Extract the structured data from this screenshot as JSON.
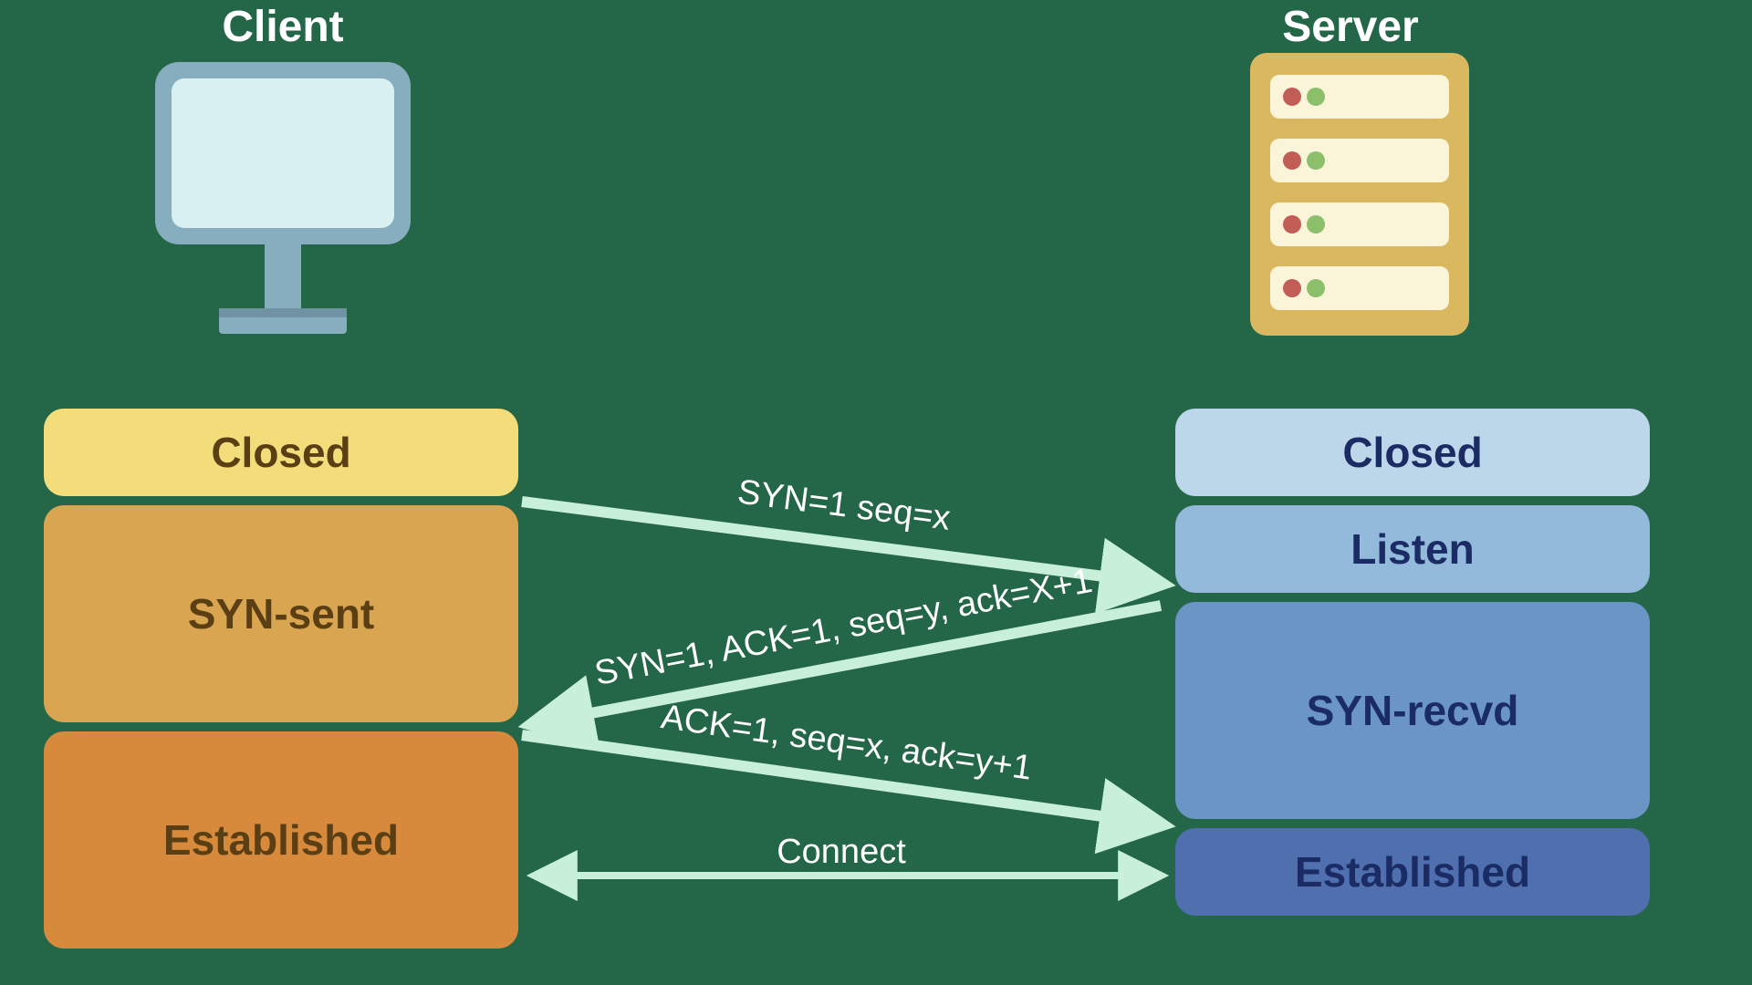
{
  "titles": {
    "client": "Client",
    "server": "Server"
  },
  "client_states": {
    "closed": "Closed",
    "syn_sent": "SYN-sent",
    "established": "Established"
  },
  "server_states": {
    "closed": "Closed",
    "listen": "Listen",
    "syn_recvd": "SYN-recvd",
    "established": "Established"
  },
  "messages": {
    "syn": "SYN=1 seq=x",
    "synack": "SYN=1, ACK=1, seq=y, ack=X+1",
    "ack": "ACK=1, seq=x, ack=y+1",
    "connect": "Connect"
  },
  "colors": {
    "bg": "#246648",
    "arrow": "#c8efd9",
    "client_box_1": "#f3dc7a",
    "client_box_2": "#d9a550",
    "client_box_3": "#d88a3c",
    "client_text": "#5a3f14",
    "server_box_1": "#bcd6ea",
    "server_box_2": "#93b9db",
    "server_box_3": "#6a95c4",
    "server_box_4": "#4f6fae",
    "server_text": "#1a2c63"
  }
}
